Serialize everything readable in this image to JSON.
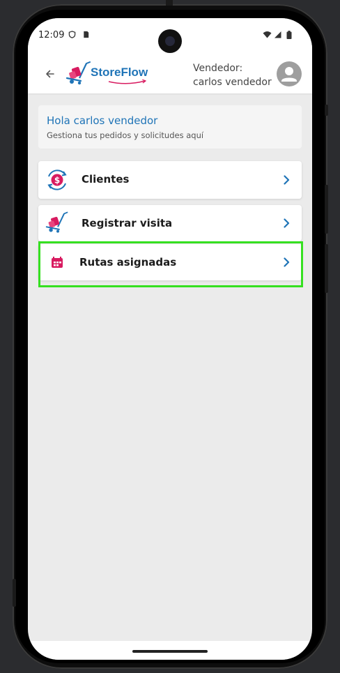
{
  "status_bar": {
    "time": "12:09"
  },
  "app_bar": {
    "brand": "StoreFlow",
    "vendor_label": "Vendedor:",
    "vendor_name": "carlos vendedor"
  },
  "greeting": {
    "title": "Hola carlos vendedor",
    "subtitle": "Gestiona tus pedidos y solicitudes aquí"
  },
  "menu": [
    {
      "label": "Clientes",
      "icon": "client-money-icon"
    },
    {
      "label": "Registrar visita",
      "icon": "cart-icon"
    },
    {
      "label": "Rutas asignadas",
      "icon": "calendar-icon",
      "highlighted": true
    }
  ],
  "colors": {
    "brand": "#1f74b7",
    "accent": "#d81b60",
    "highlight": "#35e020"
  }
}
